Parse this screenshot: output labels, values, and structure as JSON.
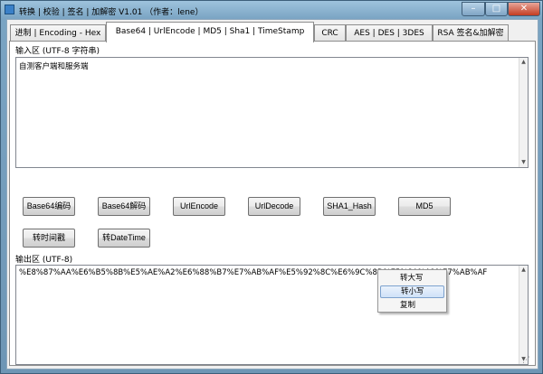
{
  "window": {
    "title": "转换 | 校验 | 签名 | 加解密 V1.01 （作者：lene）",
    "minimize_glyph": "–",
    "maximize_glyph": "□",
    "close_glyph": "✕"
  },
  "tabs": [
    {
      "label": "进制 | Encoding - Hex",
      "active": false
    },
    {
      "label": "Base64 | UrlEncode | MD5 | Sha1 | TimeStamp",
      "active": true
    },
    {
      "label": "CRC",
      "active": false
    },
    {
      "label": "AES | DES | 3DES",
      "active": false
    },
    {
      "label": "RSA 签名&加解密",
      "active": false
    }
  ],
  "input": {
    "group_label": "输入区 (UTF-8 字符串)",
    "value": "自测客户端和服务端"
  },
  "buttons": [
    "Base64编码",
    "Base64解码",
    "UrlEncode",
    "UrlDecode",
    "SHA1_Hash",
    "MD5",
    "转时间戳",
    "转DateTime"
  ],
  "output": {
    "group_label": "输出区 (UTF-8)",
    "value": "%E8%87%AA%E6%B5%8B%E5%AE%A2%E6%88%B7%E7%AB%AF%E5%92%8C%E6%9C%8D%E5%8A%A1%E7%AB%AF"
  },
  "context_menu": {
    "items": [
      {
        "label": "转大写",
        "highlighted": false
      },
      {
        "label": "转小写",
        "highlighted": true
      },
      {
        "label": "复制",
        "highlighted": false
      }
    ]
  },
  "scroll": {
    "up": "▲",
    "down": "▼"
  },
  "grip": "⋰"
}
